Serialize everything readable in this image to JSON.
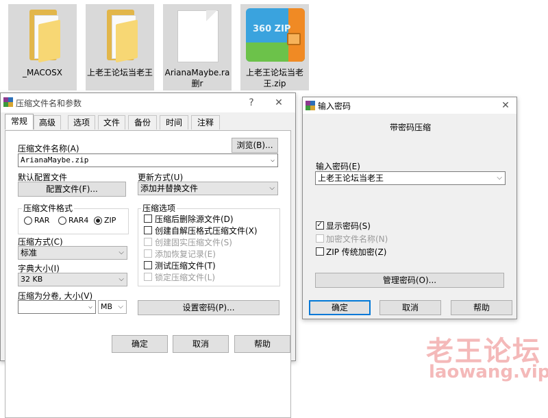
{
  "desktop": {
    "files": [
      {
        "label": "_MACOSX",
        "type": "folder"
      },
      {
        "label": "上老王论坛当老王",
        "type": "folder"
      },
      {
        "label": "ArianaMaybe.ra 删r",
        "type": "document"
      },
      {
        "label": "上老王论坛当老王.zip",
        "type": "zip-archive"
      }
    ],
    "zip_icon_text": "360 ZIP"
  },
  "archive_dialog": {
    "title": "压缩文件名和参数",
    "help_glyph": "?",
    "close_glyph": "✕",
    "tabs": [
      "常规",
      "高级",
      "选项",
      "文件",
      "备份",
      "时间",
      "注释"
    ],
    "active_tab": "常规",
    "archive_name_label": "压缩文件名称(A)",
    "browse_button": "浏览(B)...",
    "archive_name_value": "ArianaMaybe.zip",
    "default_profile_label": "默认配置文件",
    "profiles_button": "配置文件(F)...",
    "update_mode_label": "更新方式(U)",
    "update_mode_value": "添加并替换文件",
    "format_group_title": "压缩文件格式",
    "formats": [
      {
        "label": "RAR",
        "selected": false
      },
      {
        "label": "RAR4",
        "selected": false
      },
      {
        "label": "ZIP",
        "selected": true
      }
    ],
    "method_label": "压缩方式(C)",
    "method_value": "标准",
    "dict_label": "字典大小(I)",
    "dict_value": "32 KB",
    "split_label": "压缩为分卷, 大小(V)",
    "split_value": "",
    "split_unit": "MB",
    "options_group_title": "压缩选项",
    "options": [
      {
        "label": "压缩后删除源文件(D)",
        "checked": false,
        "disabled": false
      },
      {
        "label": "创建自解压格式压缩文件(X)",
        "checked": false,
        "disabled": false
      },
      {
        "label": "创建固实压缩文件(S)",
        "checked": false,
        "disabled": true
      },
      {
        "label": "添加恢复记录(E)",
        "checked": false,
        "disabled": true
      },
      {
        "label": "测试压缩文件(T)",
        "checked": false,
        "disabled": false
      },
      {
        "label": "锁定压缩文件(L)",
        "checked": false,
        "disabled": true
      }
    ],
    "set_password_button": "设置密码(P)...",
    "ok_button": "确定",
    "cancel_button": "取消",
    "help_button": "帮助"
  },
  "password_dialog": {
    "title": "输入密码",
    "close_glyph": "✕",
    "heading": "带密码压缩",
    "password_label": "输入密码(E)",
    "password_value": "上老王论坛当老王",
    "show_password_label": "显示密码(S)",
    "show_password_checked": true,
    "encrypt_names_label": "加密文件名称(N)",
    "encrypt_names_checked": false,
    "zip_legacy_label": "ZIP 传统加密(Z)",
    "zip_legacy_checked": false,
    "organize_button": "管理密码(O)...",
    "ok_button": "确定",
    "cancel_button": "取消",
    "help_button": "帮助"
  },
  "watermark": {
    "line1": "老王论坛",
    "line2": "laowang.vip"
  },
  "colors": {
    "accent": "#0078d7",
    "watermark": "#f4b9b9",
    "dialog_bg": "#f0f0f0"
  }
}
